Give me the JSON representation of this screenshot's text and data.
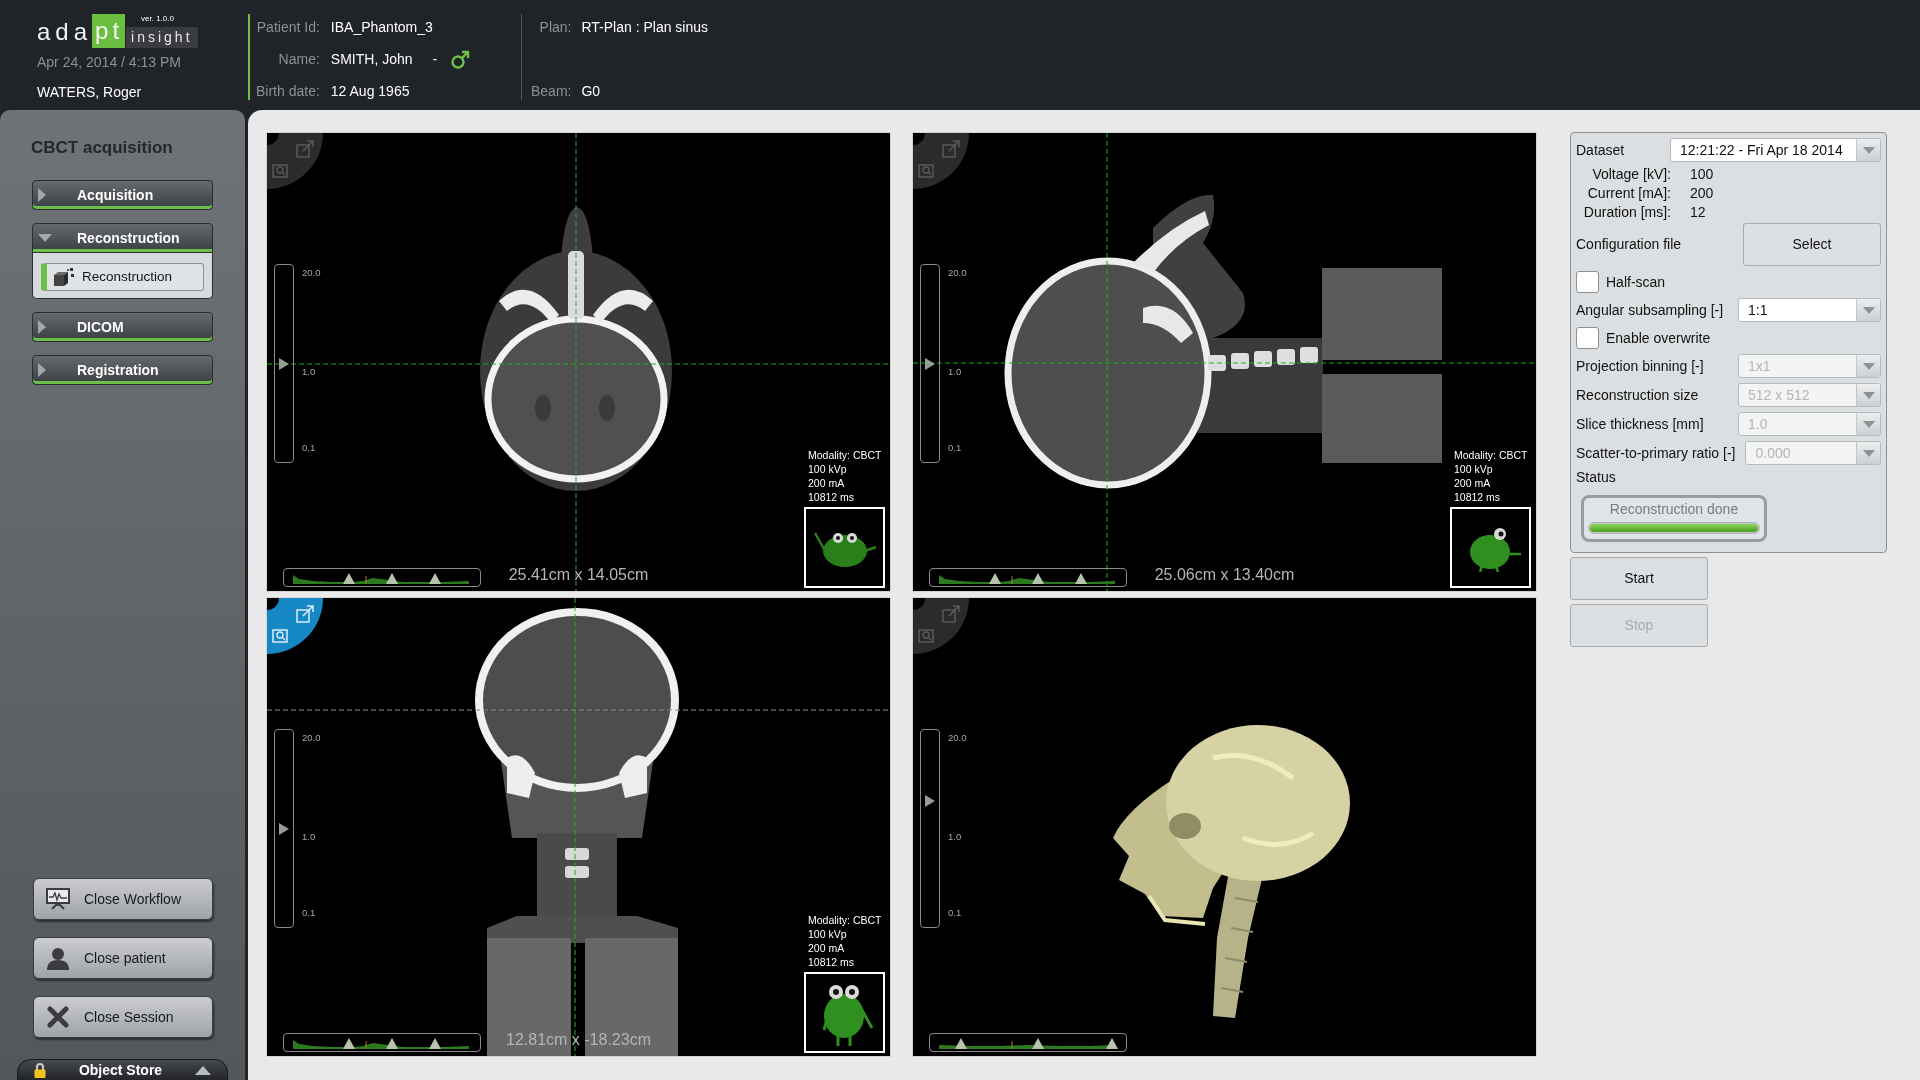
{
  "header": {
    "logo": {
      "main": "ada",
      "highlight": "pt",
      "product": "insight",
      "version": "ver. 1.0.0"
    },
    "datetime": "Apr 24, 2014 / 4:13 PM",
    "user": "WATERS, Roger",
    "patient": [
      {
        "kind": "id",
        "label": "Patient Id:",
        "value": "IBA_Phantom_3"
      },
      {
        "kind": "name",
        "label": "Name:",
        "value": "SMITH, John",
        "separator": "-"
      },
      {
        "kind": "birth_date",
        "label": "Birth date:",
        "value": "12 Aug 1965"
      }
    ],
    "plan": [
      {
        "label": "Plan:",
        "value": "RT-Plan : Plan sinus"
      },
      {
        "label": "Beam:",
        "value": "G0"
      }
    ]
  },
  "sidebar": {
    "title": "CBCT acquisition",
    "sections": [
      {
        "label": "Acquisition",
        "expanded": false
      },
      {
        "label": "Reconstruction",
        "expanded": true,
        "children": [
          {
            "label": "Reconstruction",
            "selected": true
          }
        ]
      },
      {
        "label": "DICOM",
        "expanded": false
      },
      {
        "label": "Registration",
        "expanded": false
      }
    ],
    "actions": [
      {
        "label": "Close Workflow",
        "kind": "workflow"
      },
      {
        "label": "Close patient",
        "kind": "patient"
      },
      {
        "label": "Close Session",
        "kind": "session"
      }
    ],
    "object_store": "Object Store"
  },
  "viewports": [
    {
      "kind": "axial",
      "selected": false,
      "scale": {
        "labels": [
          "20.0",
          "1.0",
          "0.1"
        ],
        "level": 0.5
      },
      "histogram": {
        "handles": [
          {
            "level": 0.33
          },
          {
            "level": 0.55
          },
          {
            "level": 0.77
          }
        ]
      },
      "dimensions": "25.41cm x 14.05cm",
      "info": [
        "Modality: CBCT",
        "100 kVp",
        "200 mA",
        "10812 ms"
      ]
    },
    {
      "kind": "sagittal",
      "selected": false,
      "scale": {
        "labels": [
          "20.0",
          "1.0",
          "0.1"
        ],
        "level": 0.5
      },
      "histogram": {
        "handles": [
          {
            "level": 0.33
          },
          {
            "level": 0.55
          },
          {
            "level": 0.77
          }
        ]
      },
      "dimensions": "25.06cm x 13.40cm",
      "info": [
        "Modality: CBCT",
        "100 kVp",
        "200 mA",
        "10812 ms"
      ]
    },
    {
      "kind": "coronal",
      "selected": true,
      "scale": {
        "labels": [
          "20.0",
          "1.0",
          "0.1"
        ],
        "level": 0.5
      },
      "histogram": {
        "handles": [
          {
            "level": 0.33
          },
          {
            "level": 0.55
          },
          {
            "level": 0.77
          }
        ]
      },
      "dimensions": "12.81cm x -18.23cm",
      "info": [
        "Modality: CBCT",
        "100 kVp",
        "200 mA",
        "10812 ms"
      ]
    },
    {
      "kind": "render3d",
      "selected": false,
      "scale": {
        "labels": [
          "20.0",
          "1.0",
          "0.1"
        ],
        "level": 0.65
      },
      "histogram": {
        "handles": [
          {
            "level": 0.16
          },
          {
            "level": 0.55
          },
          {
            "level": 0.93
          }
        ]
      }
    }
  ],
  "controls": {
    "dataset": {
      "label": "Dataset",
      "value": "12:21:22 - Fri Apr 18 2014"
    },
    "readings": [
      {
        "label": "Voltage [kV]:",
        "value": "100"
      },
      {
        "label": "Current [mA]:",
        "value": "200"
      },
      {
        "label": "Duration [ms]:",
        "value": "12"
      }
    ],
    "config": {
      "label": "Configuration file",
      "button": "Select"
    },
    "options": [
      {
        "kind": "checkbox",
        "label": "Half-scan",
        "checked": false
      },
      {
        "kind": "select",
        "label": "Angular subsampling [-]",
        "value": "1:1",
        "disabled": false
      },
      {
        "kind": "checkbox",
        "label": "Enable overwrite",
        "checked": false
      },
      {
        "kind": "select",
        "label": "Projection binning [-]",
        "value": "1x1",
        "disabled": true
      },
      {
        "kind": "select",
        "label": "Reconstruction size",
        "value": "512 x 512",
        "disabled": true
      },
      {
        "kind": "select",
        "label": "Slice thickness [mm]",
        "value": "1.0",
        "disabled": true
      },
      {
        "kind": "select",
        "label": "Scatter-to-primary ratio [-]",
        "value": "0.000",
        "disabled": true
      }
    ],
    "status": {
      "label": "Status",
      "text": "Reconstruction done",
      "level": 1
    }
  },
  "buttons": [
    {
      "label": "Start",
      "disabled": false
    },
    {
      "label": "Stop",
      "disabled": true
    }
  ]
}
